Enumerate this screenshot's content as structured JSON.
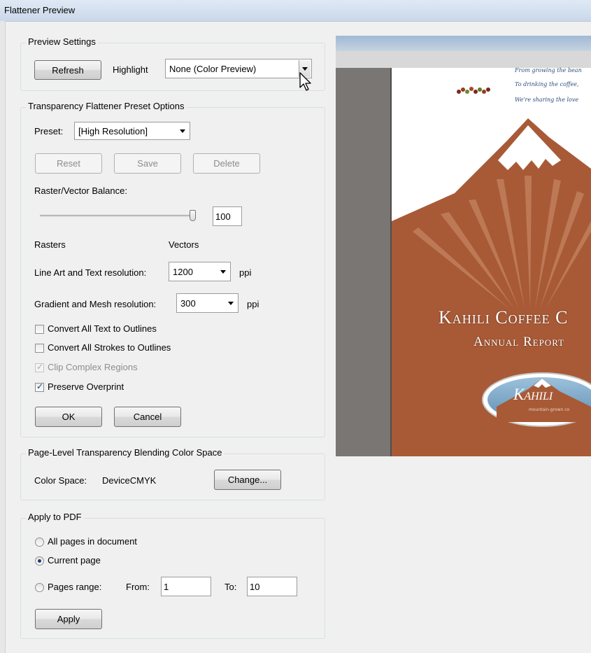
{
  "window": {
    "title": "Flattener Preview"
  },
  "preview_settings": {
    "group_title": "Preview Settings",
    "refresh_label": "Refresh",
    "highlight_label": "Highlight",
    "highlight_value": "None (Color Preview)"
  },
  "preset_options": {
    "group_title": "Transparency Flattener Preset Options",
    "preset_label": "Preset:",
    "preset_value": "[High Resolution]",
    "reset_label": "Reset",
    "save_label": "Save",
    "delete_label": "Delete",
    "balance_label": "Raster/Vector Balance:",
    "balance_value": "100",
    "rasters_label": "Rasters",
    "vectors_label": "Vectors",
    "line_art_label": "Line Art and Text resolution:",
    "line_art_value": "1200",
    "line_art_unit": "ppi",
    "gradient_label": "Gradient and Mesh resolution:",
    "gradient_value": "300",
    "gradient_unit": "ppi",
    "checkboxes": [
      {
        "label": "Convert All Text to Outlines",
        "checked": false,
        "enabled": true
      },
      {
        "label": "Convert All Strokes to Outlines",
        "checked": false,
        "enabled": true
      },
      {
        "label": "Clip Complex Regions",
        "checked": true,
        "enabled": false
      },
      {
        "label": "Preserve Overprint",
        "checked": true,
        "enabled": true
      }
    ],
    "ok_label": "OK",
    "cancel_label": "Cancel"
  },
  "blending": {
    "group_title": "Page-Level Transparency Blending Color Space",
    "color_space_label": "Color Space:",
    "color_space_value": "DeviceCMYK",
    "change_label": "Change..."
  },
  "apply_pdf": {
    "group_title": "Apply to PDF",
    "radios": [
      {
        "label": "All pages in document",
        "checked": false
      },
      {
        "label": "Current page",
        "checked": true
      },
      {
        "label": "Pages range:",
        "checked": false
      }
    ],
    "from_label": "From:",
    "from_value": "1",
    "to_label": "To:",
    "to_value": "10",
    "apply_label": "Apply"
  },
  "preview": {
    "tagline_1": "From growing the bean",
    "tagline_2": "To drinking the coffee,",
    "tagline_3": "We're sharing the love",
    "company_title": "Kahili Coffee C",
    "report_title": "Annual Report",
    "logo_text": "Kahili",
    "logo_subtext": "mountain-grown co",
    "colors": {
      "mountain": "#a85a37",
      "snow": "#ffffff",
      "logo_sky": "#7fa9c9",
      "sidebar": "#797673"
    }
  }
}
